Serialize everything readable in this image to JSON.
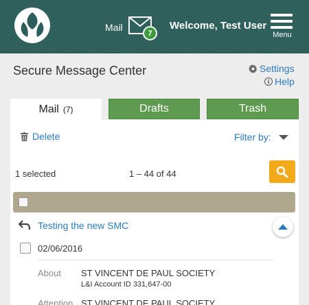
{
  "header": {
    "mail_label": "Mail",
    "mail_badge": "7",
    "welcome": "Welcome, Test User",
    "menu_label": "Menu"
  },
  "page": {
    "title": "Secure Message Center",
    "settings_label": "Settings",
    "help_label": "Help"
  },
  "tabs": [
    {
      "label": "Mail",
      "count": "(7)",
      "active": true
    },
    {
      "label": "Drafts",
      "active": false
    },
    {
      "label": "Trash",
      "active": false
    }
  ],
  "toolbar": {
    "delete_label": "Delete",
    "filter_label": "Filter by:",
    "selected_text": "1 selected",
    "range_text": "1 – 44 of 44"
  },
  "message": {
    "subject": "Testing the new SMC",
    "date": "02/06/2016",
    "about_label": "About",
    "about_value": "ST VINCENT DE PAUL SOCIETY",
    "about_account": "L&I Account ID 331,647-00",
    "attention_label": "Attention",
    "attention_value": "ST VINCENT DE PAUL SOCIETY"
  },
  "colors": {
    "header_bg": "#2c5f5b",
    "tab_green": "#5e9a4f",
    "link_blue": "#2a7abf",
    "search_orange": "#f2a91a",
    "select_bar": "#b0a88e",
    "badge_green": "#3d9a3d"
  },
  "icons": {
    "logo": "logo-icon",
    "mail": "envelope-icon",
    "menu": "hamburger-icon",
    "settings": "gear-icon",
    "help": "info-icon",
    "delete": "trash-icon",
    "filter": "caret-down-icon",
    "search": "search-icon",
    "reply": "reply-icon",
    "collapse": "chevron-up-icon"
  }
}
